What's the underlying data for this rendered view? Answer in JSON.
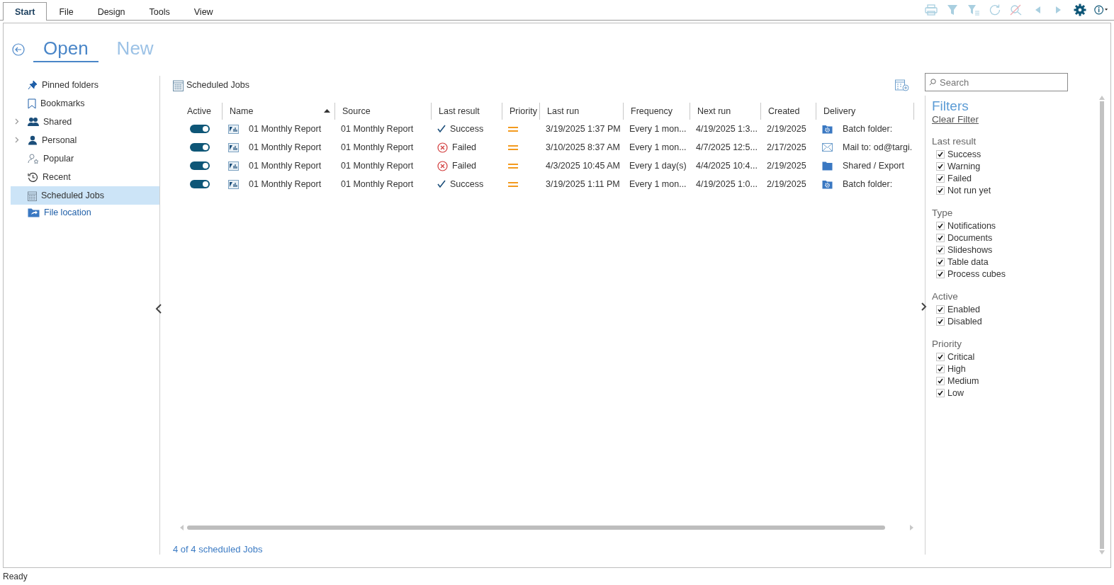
{
  "menu_tabs": [
    {
      "label": "Start",
      "selected": true
    },
    {
      "label": "File",
      "selected": false
    },
    {
      "label": "Design",
      "selected": false
    },
    {
      "label": "Tools",
      "selected": false
    },
    {
      "label": "View",
      "selected": false
    }
  ],
  "toolbar": [
    {
      "kind": "print",
      "disabled": true
    },
    {
      "kind": "filter",
      "disabled": true
    },
    {
      "kind": "filter-list",
      "disabled": true
    },
    {
      "kind": "refresh",
      "disabled": true
    },
    {
      "kind": "clear-search",
      "disabled": true
    },
    {
      "kind": "back",
      "disabled": true
    },
    {
      "kind": "forward",
      "disabled": true
    },
    {
      "kind": "settings",
      "disabled": false
    },
    {
      "kind": "info",
      "disabled": false
    }
  ],
  "page_tabs": [
    {
      "label": "Open",
      "selected": true
    },
    {
      "label": "New",
      "selected": false
    }
  ],
  "sidebar": {
    "items": [
      {
        "label": "Pinned folders",
        "kind": "item",
        "selected": false
      },
      {
        "label": "Bookmarks",
        "kind": "item",
        "selected": false
      },
      {
        "label": "Shared",
        "kind": "group",
        "selected": false
      },
      {
        "label": "Personal",
        "kind": "group",
        "selected": false
      },
      {
        "label": "Popular",
        "kind": "item",
        "selected": false
      },
      {
        "label": "Recent",
        "kind": "item",
        "selected": false
      },
      {
        "label": "Scheduled Jobs",
        "kind": "item",
        "selected": true
      },
      {
        "label": "File location",
        "kind": "link",
        "selected": false
      }
    ]
  },
  "content": {
    "title": "Scheduled Jobs",
    "table": {
      "columns": [
        "Active",
        "Name",
        "Source",
        "Last result",
        "Priority",
        "Last run",
        "Frequency",
        "Next run",
        "Created",
        "Delivery"
      ],
      "rows": [
        {
          "active": true,
          "name": "01 Monthly Report",
          "source": "01 Monthly Report",
          "last_result": {
            "kind": "success",
            "label": "Success"
          },
          "priority": {
            "kind": "medium"
          },
          "last_run": "3/19/2025 1:37 PM",
          "frequency": "Every 1 mon...",
          "next_run": "4/19/2025 1:3...",
          "created": "2/19/2025",
          "delivery": {
            "kind": "batch",
            "label": "Batch folder:"
          }
        },
        {
          "active": true,
          "name": "01 Monthly Report",
          "source": "01 Monthly Report",
          "last_result": {
            "kind": "failed",
            "label": "Failed"
          },
          "priority": {
            "kind": "medium"
          },
          "last_run": "3/10/2025 8:37 AM",
          "frequency": "Every 1 mon...",
          "next_run": "4/7/2025 12:5...",
          "created": "2/17/2025",
          "delivery": {
            "kind": "mail",
            "label": "Mail to: od@targi."
          }
        },
        {
          "active": true,
          "name": "01 Monthly Report",
          "source": "01 Monthly Report",
          "last_result": {
            "kind": "failed",
            "label": "Failed"
          },
          "priority": {
            "kind": "medium"
          },
          "last_run": "4/3/2025 10:45 AM",
          "frequency": "Every 1 day(s)",
          "next_run": "4/4/2025 10:4...",
          "created": "2/19/2025",
          "delivery": {
            "kind": "folder",
            "label": "Shared / Export"
          }
        },
        {
          "active": true,
          "name": "01 Monthly Report",
          "source": "01 Monthly Report",
          "last_result": {
            "kind": "success",
            "label": "Success"
          },
          "priority": {
            "kind": "medium"
          },
          "last_run": "3/19/2025 1:11 PM",
          "frequency": "Every 1 mon...",
          "next_run": "4/19/2025 1:0...",
          "created": "2/19/2025",
          "delivery": {
            "kind": "batch",
            "label": "Batch folder:"
          }
        }
      ]
    },
    "footer": "4 of 4 scheduled Jobs"
  },
  "filters": {
    "search": {
      "placeholder": "Search"
    },
    "title": "Filters",
    "clear": "Clear Filter",
    "groups": [
      {
        "title": "Last result",
        "items": [
          {
            "label": "Success",
            "checked": true
          },
          {
            "label": "Warning",
            "checked": true
          },
          {
            "label": "Failed",
            "checked": true
          },
          {
            "label": "Not run yet",
            "checked": true
          }
        ]
      },
      {
        "title": "Type",
        "items": [
          {
            "label": "Notifications",
            "checked": true
          },
          {
            "label": "Documents",
            "checked": true
          },
          {
            "label": "Slideshows",
            "checked": true
          },
          {
            "label": "Table data",
            "checked": true
          },
          {
            "label": "Process cubes",
            "checked": true
          }
        ]
      },
      {
        "title": "Active",
        "items": [
          {
            "label": "Enabled",
            "checked": true
          },
          {
            "label": "Disabled",
            "checked": true
          }
        ]
      },
      {
        "title": "Priority",
        "items": [
          {
            "label": "Critical",
            "checked": true
          },
          {
            "label": "High",
            "checked": true
          },
          {
            "label": "Medium",
            "checked": true
          },
          {
            "label": "Low",
            "checked": true
          }
        ]
      }
    ]
  },
  "status_bar": "Ready"
}
